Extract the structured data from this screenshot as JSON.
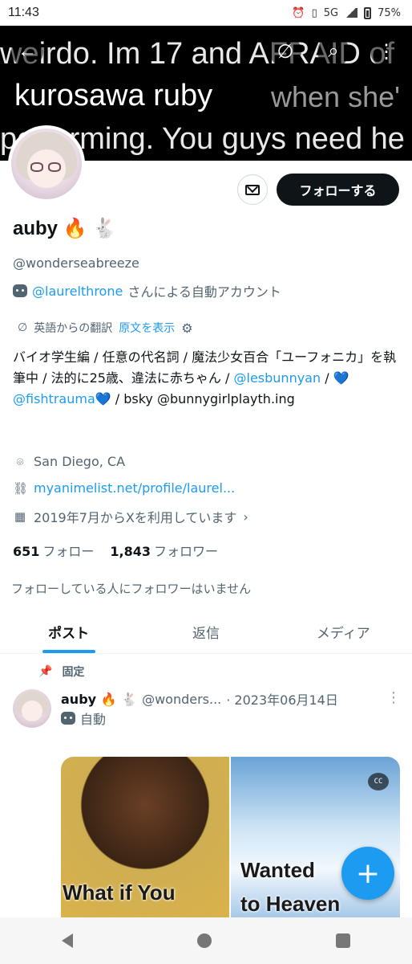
{
  "status_bar": {
    "time": "11:43",
    "network": "5G",
    "battery": "75%"
  },
  "banner": {
    "line1": "weirdo. Im 17 and AFRAID of",
    "line2a": "kurosawa ruby",
    "line2b": "when she'",
    "line3": "performing. You guys need he"
  },
  "profile": {
    "name": "auby 🔥 🐇",
    "handle": "@wonderseabreeze",
    "automated_by_handle": "@laurelthrone",
    "automated_suffix": "さんによる自動アカウント",
    "translated_from": "英語からの翻訳",
    "show_original": "原文を表示",
    "bio_part1": "バイオ学生編 / 任意の代名詞 / 魔法少女百合「ユーフォニカ」を執筆中 / 法的に25歳、違法に赤ちゃん / ",
    "bio_mention1": "@lesbunnyan",
    "bio_sep": " / ",
    "bio_heart1": "💙",
    "bio_mention2": "@fishtrauma",
    "bio_heart2": "💙",
    "bio_part2": " / bsky @bunnygirlplayth.ing",
    "location": "San Diego, CA",
    "link": "myanimelist.net/profile/laurel...",
    "joined": "2019年7月からXを利用しています",
    "following_count": "651",
    "following_label": "フォロー",
    "followers_count": "1,843",
    "followers_label": "フォロワー",
    "no_mutual_followers": "フォローしている人にフォロワーはいません"
  },
  "buttons": {
    "follow": "フォローする"
  },
  "tabs": [
    {
      "label": "ポスト",
      "active": true
    },
    {
      "label": "返信",
      "active": false
    },
    {
      "label": "メディア",
      "active": false
    }
  ],
  "pinned_post": {
    "pinned_label": "固定",
    "author_name": "auby 🔥 🐇",
    "author_handle": "@wonders...",
    "date": "· 2023年06月14日",
    "automated_label": "自動",
    "meme_text_left": "What if You",
    "meme_text_right1": "Wanted",
    "meme_text_right2": "to Heaven",
    "caption_badge": "CC"
  },
  "fab_label": "+",
  "accent_color": "#1d9bf0"
}
